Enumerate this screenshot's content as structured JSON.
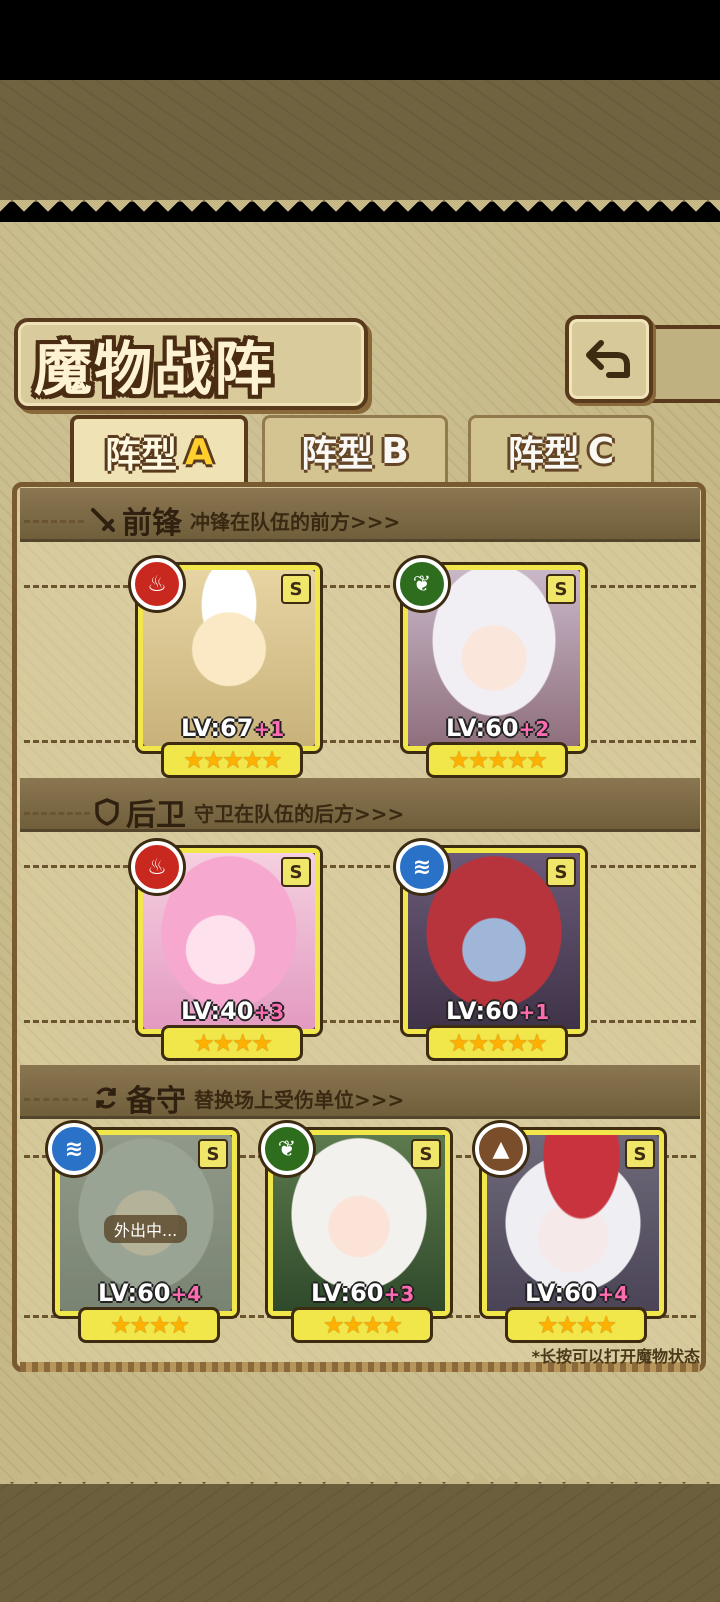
{
  "header": {
    "title": "魔物战阵"
  },
  "tabs": [
    {
      "label": "阵型",
      "letter": "A",
      "active": true
    },
    {
      "label": "阵型",
      "letter": "B",
      "active": false
    },
    {
      "label": "阵型",
      "letter": "C",
      "active": false
    }
  ],
  "sections": {
    "front": {
      "name": "前锋",
      "desc": "冲锋在队伍的前方>>>"
    },
    "rear": {
      "name": "后卫",
      "desc": "守卫在队伍的后方>>>"
    },
    "reserve": {
      "name": "备守",
      "desc": "替换场上受伤单位>>>"
    }
  },
  "cards": {
    "front1": {
      "rank": "S",
      "level": "LV:67",
      "plus": "+1",
      "stars": "★★★★★",
      "element": "fire",
      "element_color": "#c8281e"
    },
    "front2": {
      "rank": "S",
      "level": "LV:60",
      "plus": "+2",
      "stars": "★★★★★",
      "element": "leaf",
      "element_color": "#2e6d1e"
    },
    "rear1": {
      "rank": "S",
      "level": "LV:40",
      "plus": "+3",
      "stars": "★★★★",
      "element": "fire",
      "element_color": "#c8281e"
    },
    "rear2": {
      "rank": "S",
      "level": "LV:60",
      "plus": "+1",
      "stars": "★★★★★",
      "element": "water",
      "element_color": "#2a72c8"
    },
    "res1": {
      "rank": "S",
      "level": "LV:60",
      "plus": "+4",
      "stars": "★★★★",
      "element": "water",
      "element_color": "#2a72c8",
      "status": "外出中..."
    },
    "res2": {
      "rank": "S",
      "level": "LV:60",
      "plus": "+3",
      "stars": "★★★★",
      "element": "leaf",
      "element_color": "#2e6d1e"
    },
    "res3": {
      "rank": "S",
      "level": "LV:60",
      "plus": "+4",
      "stars": "★★★★",
      "element": "earth",
      "element_color": "#7a4e2a"
    }
  },
  "hint": "*长按可以打开魔物状态"
}
